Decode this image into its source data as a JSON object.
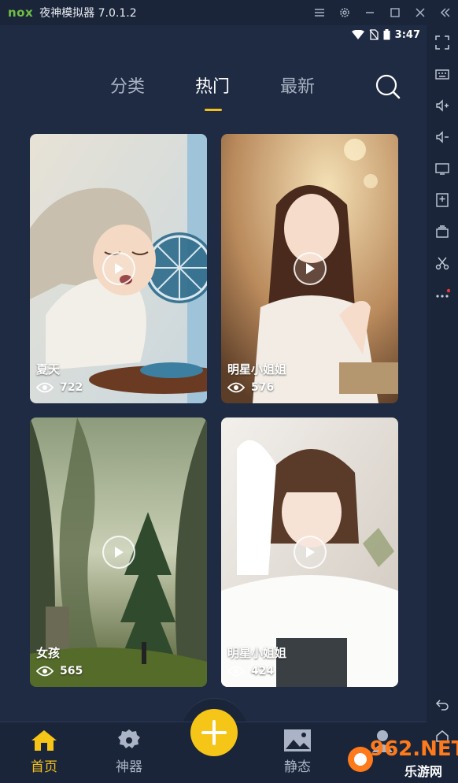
{
  "titlebar": {
    "logo": "nox",
    "title": "夜神模拟器 7.0.1.2",
    "controls": [
      "menu-icon",
      "gear-icon",
      "minimize-icon",
      "maximize-icon",
      "close-icon",
      "collapse-icon"
    ]
  },
  "statusbar": {
    "time": "3:47"
  },
  "tabs": [
    {
      "label": "分类",
      "active": false
    },
    {
      "label": "热门",
      "active": true
    },
    {
      "label": "最新",
      "active": false
    }
  ],
  "cards": [
    {
      "title": "夏天",
      "views": "722",
      "theme": "anime"
    },
    {
      "title": "明星小姐姐",
      "views": "576",
      "theme": "portrait-warm"
    },
    {
      "title": "女孩",
      "views": "565",
      "theme": "forest"
    },
    {
      "title": "明星小姐姐",
      "views": "424",
      "theme": "portrait-light"
    }
  ],
  "bottom_nav": [
    {
      "label": "首页",
      "icon": "home-icon",
      "active": true
    },
    {
      "label": "神器",
      "icon": "gear-icon",
      "active": false
    },
    {
      "label": "静态",
      "icon": "image-icon",
      "active": false
    },
    {
      "label": "",
      "icon": "user-icon",
      "active": false
    }
  ],
  "watermark": {
    "brand": "962.NET",
    "sub": "乐游网"
  },
  "colors": {
    "accent": "#f5c518",
    "background": "#1f2b42",
    "nav_background": "#1b2539"
  }
}
